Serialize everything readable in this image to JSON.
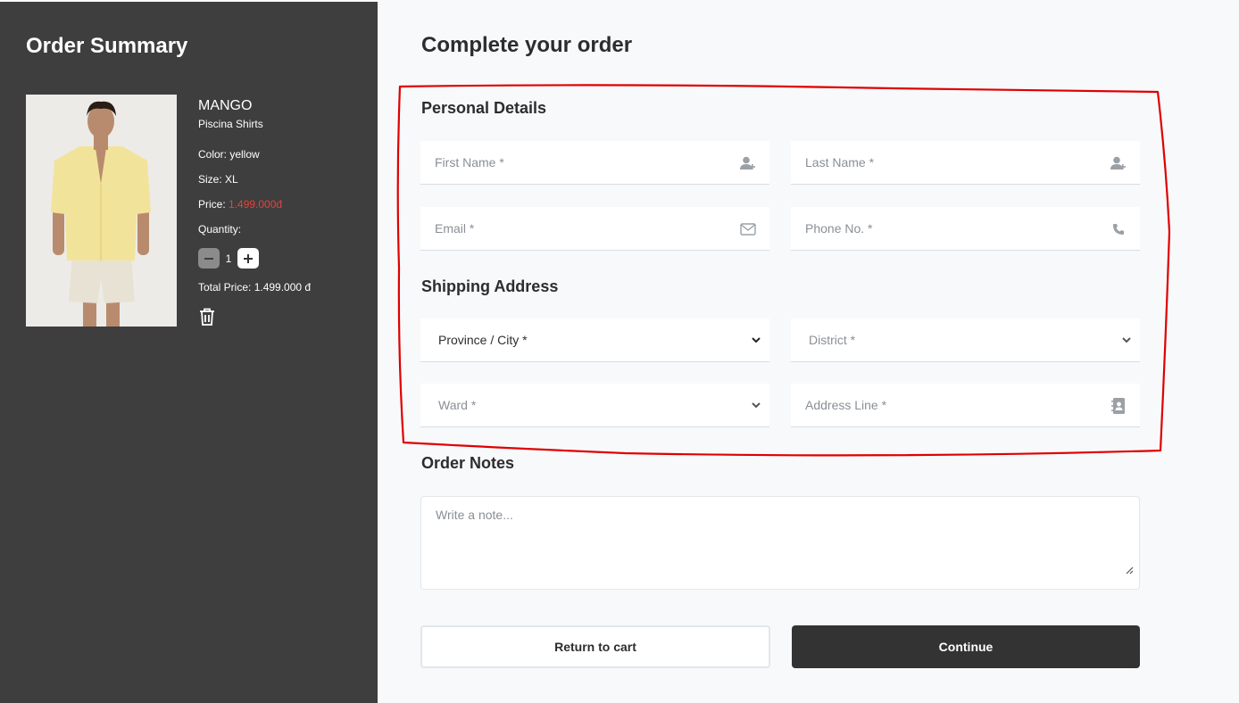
{
  "summary": {
    "title": "Order Summary",
    "product": {
      "brand": "MANGO",
      "name": "Piscina Shirts",
      "color": "Color: yellow",
      "size": "Size: XL",
      "price_label": "Price: ",
      "price_value": "1.499.000đ",
      "quantity_label": "Quantity:",
      "quantity": "1",
      "total": "Total Price: 1.499.000 đ"
    }
  },
  "form": {
    "title": "Complete your order",
    "personal_title": "Personal Details",
    "first_name": "First Name *",
    "last_name": "Last Name *",
    "email": "Email *",
    "phone": "Phone No. *",
    "shipping_title": "Shipping Address",
    "province": "Province / City *",
    "district": "District *",
    "ward": "Ward *",
    "address": "Address Line *",
    "notes_title": "Order Notes",
    "notes_placeholder": "Write a note...",
    "return_label": "Return to cart",
    "continue_label": "Continue"
  },
  "colors": {
    "sidebar_bg": "#3e3e3e",
    "price_accent": "#e8403c",
    "annotation": "#e00000",
    "continue_bg": "#333333"
  },
  "icons": [
    "user-plus-icon",
    "envelope-icon",
    "phone-icon",
    "chevron-down-icon",
    "address-book-icon",
    "trash-icon",
    "minus-icon",
    "plus-icon"
  ]
}
